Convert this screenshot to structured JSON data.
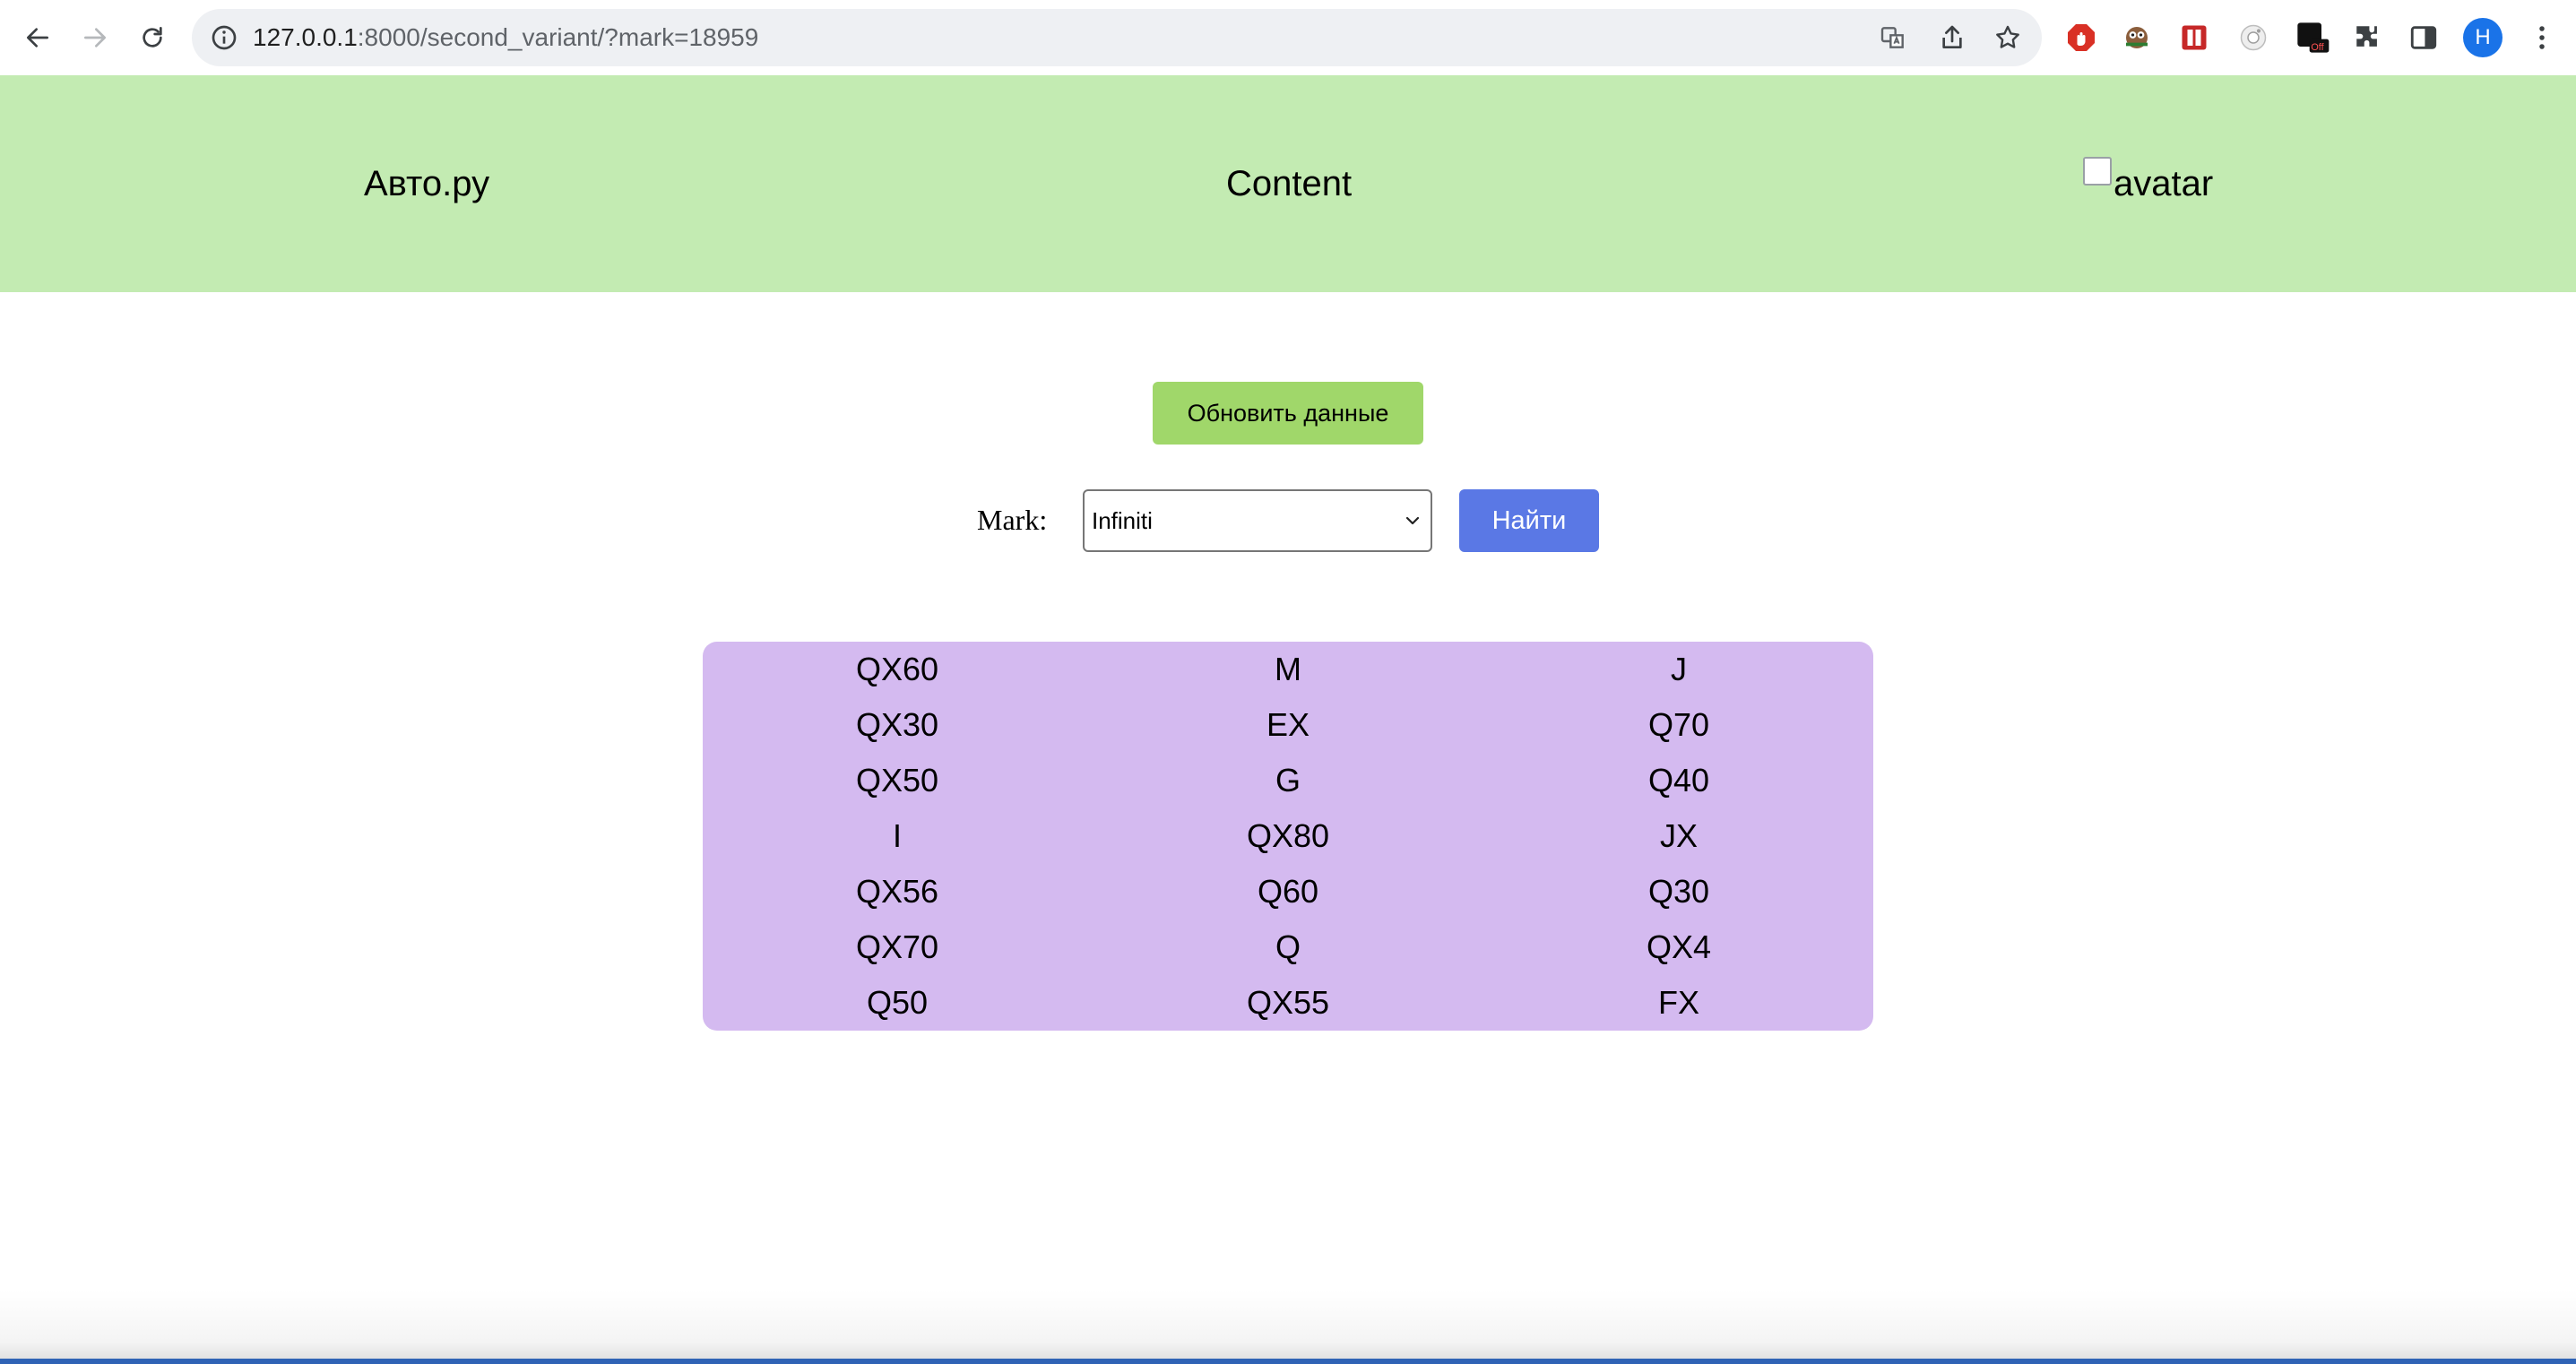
{
  "browser": {
    "url_host": "127.0.0.1",
    "url_rest": ":8000/second_variant/?mark=18959",
    "profile_initial": "H",
    "extension_badge": "Off"
  },
  "header": {
    "logo": "Авто.ру",
    "title": "Content",
    "avatar_alt": "avatar",
    "background": "#c3ebb2"
  },
  "controls": {
    "refresh_label": "Обновить данные",
    "mark_label": "Mark:",
    "mark_selected": "Infiniti",
    "find_label": "Найти"
  },
  "models": [
    [
      "QX60",
      "M",
      "J"
    ],
    [
      "QX30",
      "EX",
      "Q70"
    ],
    [
      "QX50",
      "G",
      "Q40"
    ],
    [
      "I",
      "QX80",
      "JX"
    ],
    [
      "QX56",
      "Q60",
      "Q30"
    ],
    [
      "QX70",
      "Q",
      "QX4"
    ],
    [
      "Q50",
      "QX55",
      "FX"
    ]
  ],
  "colors": {
    "refresh_button": "#a0d76a",
    "find_button": "#5a78e5",
    "models_panel": "#d4baf0"
  }
}
